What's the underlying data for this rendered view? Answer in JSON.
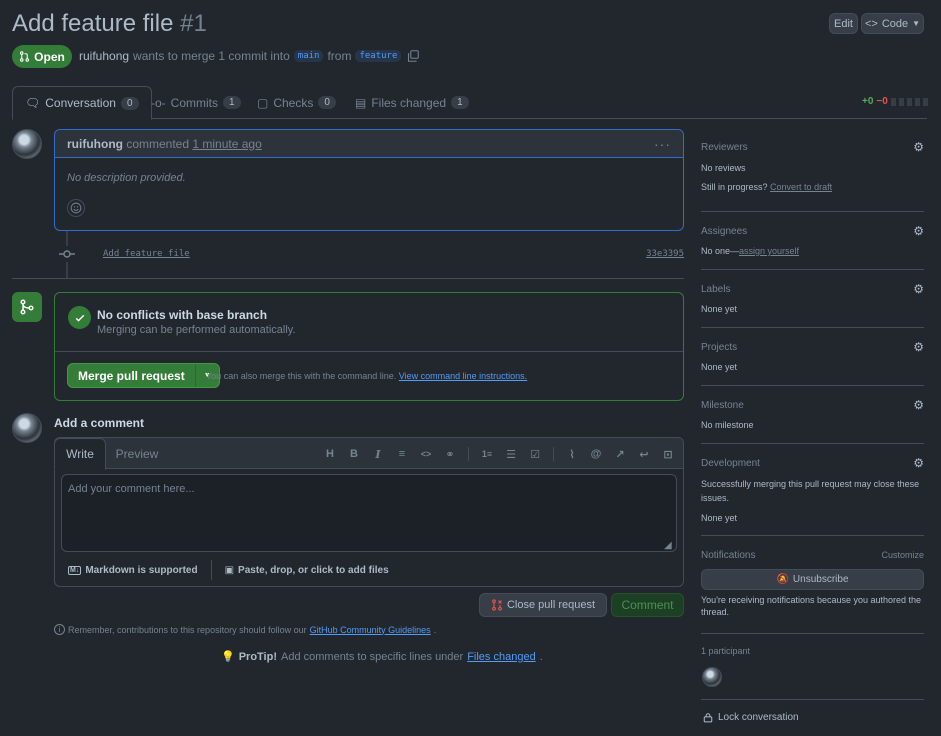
{
  "header": {
    "title": "Add feature file",
    "number": "#1",
    "edit_label": "Edit",
    "code_label": "Code",
    "state_label": "Open",
    "author": "ruifuhong",
    "meta_middle": "wants to merge 1 commit into",
    "base_branch": "main",
    "meta_from": "from",
    "head_branch": "feature"
  },
  "tabs": [
    {
      "label": "Conversation",
      "count": "0",
      "icon": "comment-discussion-icon"
    },
    {
      "label": "Commits",
      "count": "1",
      "icon": "git-commit-icon"
    },
    {
      "label": "Checks",
      "count": "0",
      "icon": "checklist-icon"
    },
    {
      "label": "Files changed",
      "count": "1",
      "icon": "file-diff-icon"
    }
  ],
  "diffstat": {
    "additions": "+0",
    "deletions": "−0"
  },
  "comment": {
    "author": "ruifuhong",
    "action": "commented",
    "time": "1 minute ago",
    "body": "No description provided."
  },
  "commit": {
    "message": "Add feature file",
    "sha": "33e3395"
  },
  "merge": {
    "title": "No conflicts with base branch",
    "subtitle": "Merging can be performed automatically.",
    "button": "Merge pull request",
    "hint": "You can also merge this with the command line.",
    "hint_link": "View command line instructions."
  },
  "new_comment": {
    "heading": "Add a comment",
    "tab_write": "Write",
    "tab_preview": "Preview",
    "placeholder": "Add your comment here...",
    "markdown_note": "Markdown is supported",
    "attach_note": "Paste, drop, or click to add files",
    "close_button": "Close pull request",
    "comment_button": "Comment"
  },
  "guidelines": {
    "text": "Remember, contributions to this repository should follow our",
    "link": "GitHub Community Guidelines",
    "end": "."
  },
  "protip": {
    "label": "ProTip!",
    "text": "Add comments to specific lines under",
    "link": "Files changed",
    "end": "."
  },
  "sidebar": {
    "reviewers": {
      "title": "Reviewers",
      "value": "No reviews",
      "progress": "Still in progress?",
      "draft_link": "Convert to draft"
    },
    "assignees": {
      "title": "Assignees",
      "value": "No one—",
      "link": "assign yourself"
    },
    "labels": {
      "title": "Labels",
      "value": "None yet"
    },
    "projects": {
      "title": "Projects",
      "value": "None yet"
    },
    "milestone": {
      "title": "Milestone",
      "value": "No milestone"
    },
    "development": {
      "title": "Development",
      "value": "Successfully merging this pull request may close these issues.",
      "none": "None yet"
    },
    "notifications": {
      "title": "Notifications",
      "customize": "Customize",
      "button": "Unsubscribe",
      "note": "You're receiving notifications because you authored the thread."
    },
    "participants": {
      "title": "1 participant"
    },
    "lock": {
      "label": "Lock conversation"
    }
  },
  "colors": {
    "accent": "#539bf5",
    "success": "#347d39",
    "danger": "#e5534b",
    "bg": "#22272e"
  }
}
